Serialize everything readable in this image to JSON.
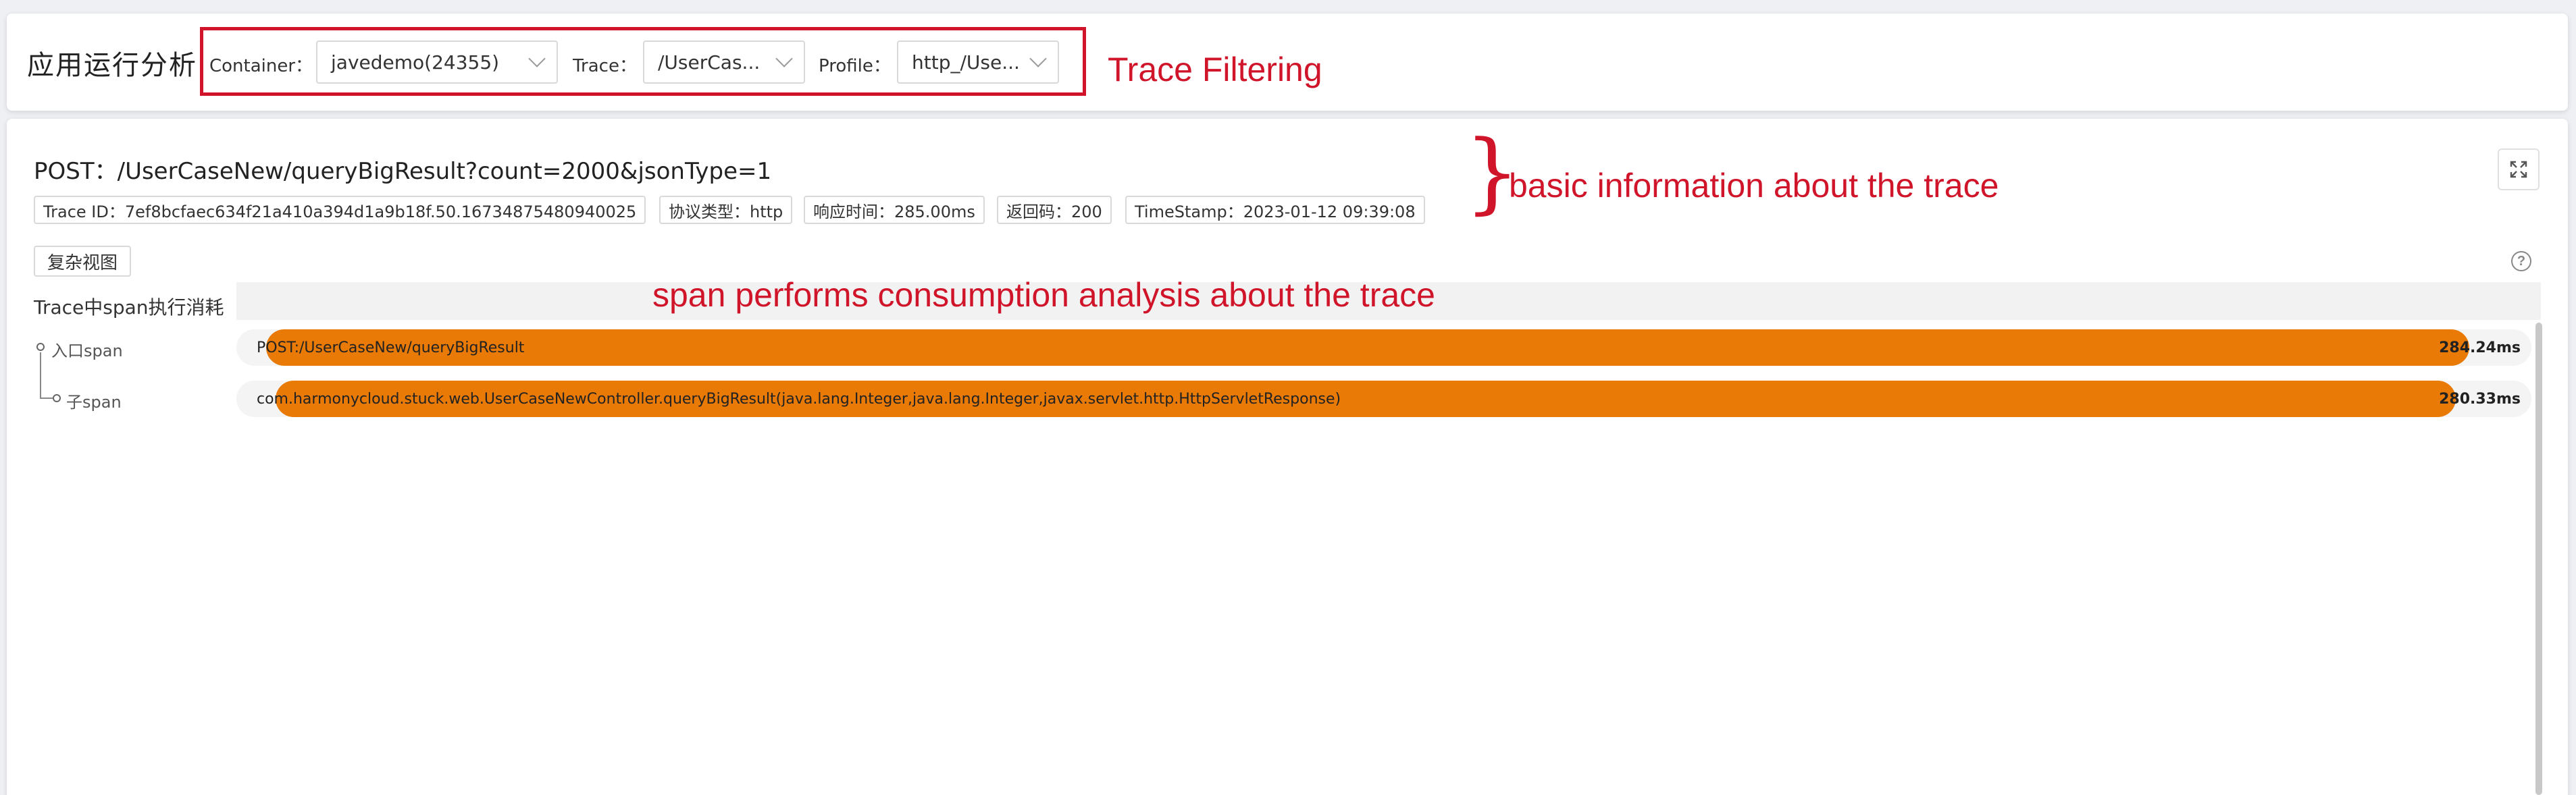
{
  "app": {
    "title": "应用运行分析"
  },
  "filters": {
    "container_label": "Container：",
    "container_value": "javedemo(24355)",
    "trace_label": "Trace：",
    "trace_value": "/UserCas...",
    "profile_label": "Profile：",
    "profile_value": "http_/Use..."
  },
  "annotations": {
    "filtering": "Trace Filtering",
    "basic_info_brace": "}",
    "basic_info": "basic information about the trace",
    "span_analysis": "span performs consumption analysis about the trace"
  },
  "trace": {
    "title": "POST：/UserCaseNew/queryBigResult?count=2000&jsonType=1",
    "tags": [
      "Trace ID：7ef8bcfaec634f21a410a394d1a9b18f.50.16734875480940025",
      "协议类型：http",
      "响应时间：285.00ms",
      "返回码：200",
      "TimeStamp：2023-01-12 09:39:08"
    ]
  },
  "controls": {
    "complex_view_label": "复杂视图",
    "help_icon": "?",
    "expand_icon": "expand-icon"
  },
  "span_chart": {
    "header_label": "Trace中span执行消耗",
    "tree": {
      "entry_label": "入口span",
      "child_label": "子span"
    },
    "rows": [
      {
        "name": "POST:/UserCaseNew/queryBigResult",
        "duration": "284.24ms",
        "start_fraction": 0.013,
        "length_fraction": 0.96
      },
      {
        "name": "com.harmonycloud.stuck.web.UserCaseNewController.queryBigResult(java.lang.Integer,java.lang.Integer,javax.servlet.http.HttpServletResponse)",
        "duration": "280.33ms",
        "start_fraction": 0.017,
        "length_fraction": 0.95
      }
    ],
    "bar_color": "#e87a05"
  },
  "colors": {
    "annotation": "#d0142a",
    "background": "#eef0f4"
  }
}
